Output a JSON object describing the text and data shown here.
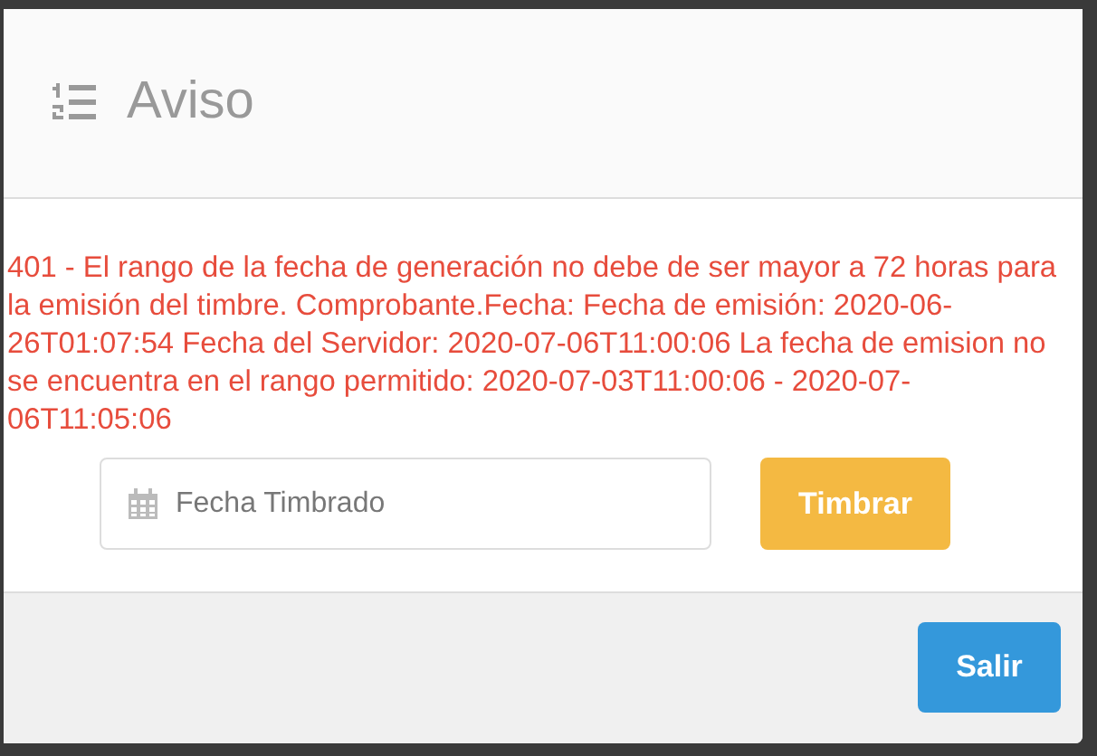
{
  "modal": {
    "title": "Aviso",
    "message": "401 - El rango de la fecha de generación no debe de ser mayor a 72 horas para la emisión del timbre. Comprobante.Fecha: Fecha de emisión: 2020-06-26T01:07:54 Fecha del Servidor: 2020-07-06T11:00:06 La fecha de emision no se encuentra en el rango permitido: 2020-07-03T11:00:06 - 2020-07-06T11:05:06",
    "date_field": {
      "placeholder": "Fecha Timbrado"
    },
    "stamp_button": "Timbrar",
    "exit_button": "Salir"
  }
}
